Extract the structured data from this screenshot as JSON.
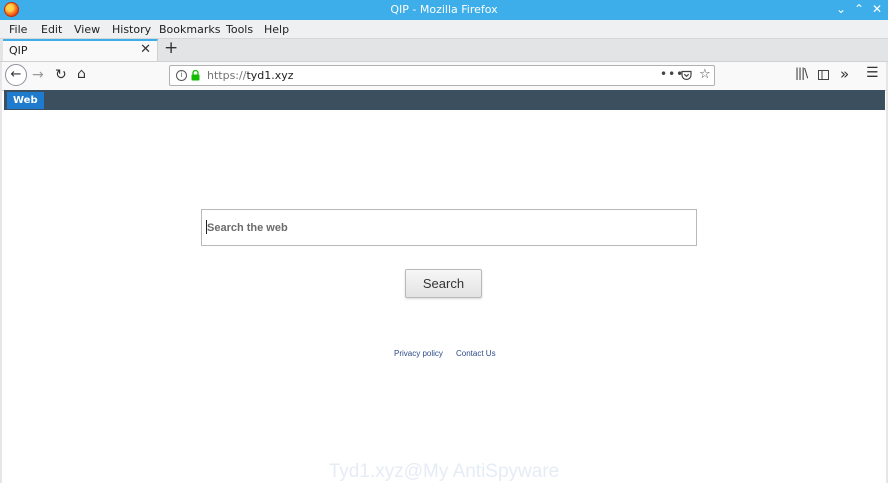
{
  "window": {
    "title": "QIP - Mozilla Firefox"
  },
  "menu": {
    "items": [
      {
        "label": "File"
      },
      {
        "label": "Edit"
      },
      {
        "label": "View"
      },
      {
        "label": "History"
      },
      {
        "label": "Bookmarks"
      },
      {
        "label": "Tools"
      },
      {
        "label": "Help"
      }
    ]
  },
  "tabs": [
    {
      "label": "QIP",
      "active": true
    }
  ],
  "toolbar": {
    "url_protocol": "https://",
    "url_host": "tyd1.xyz"
  },
  "site": {
    "nav_tab": "Web",
    "search_placeholder": "Search the web",
    "search_button": "Search",
    "footer_links": [
      {
        "label": "Privacy policy"
      },
      {
        "label": "Contact Us"
      }
    ]
  },
  "watermark": "Tyd1.xyz@My AntiSpyware",
  "colors": {
    "titlebar": "#3daee9",
    "site_header": "#3c4f5e",
    "web_tab": "#1f7bcd",
    "link": "#2d4a8a"
  }
}
